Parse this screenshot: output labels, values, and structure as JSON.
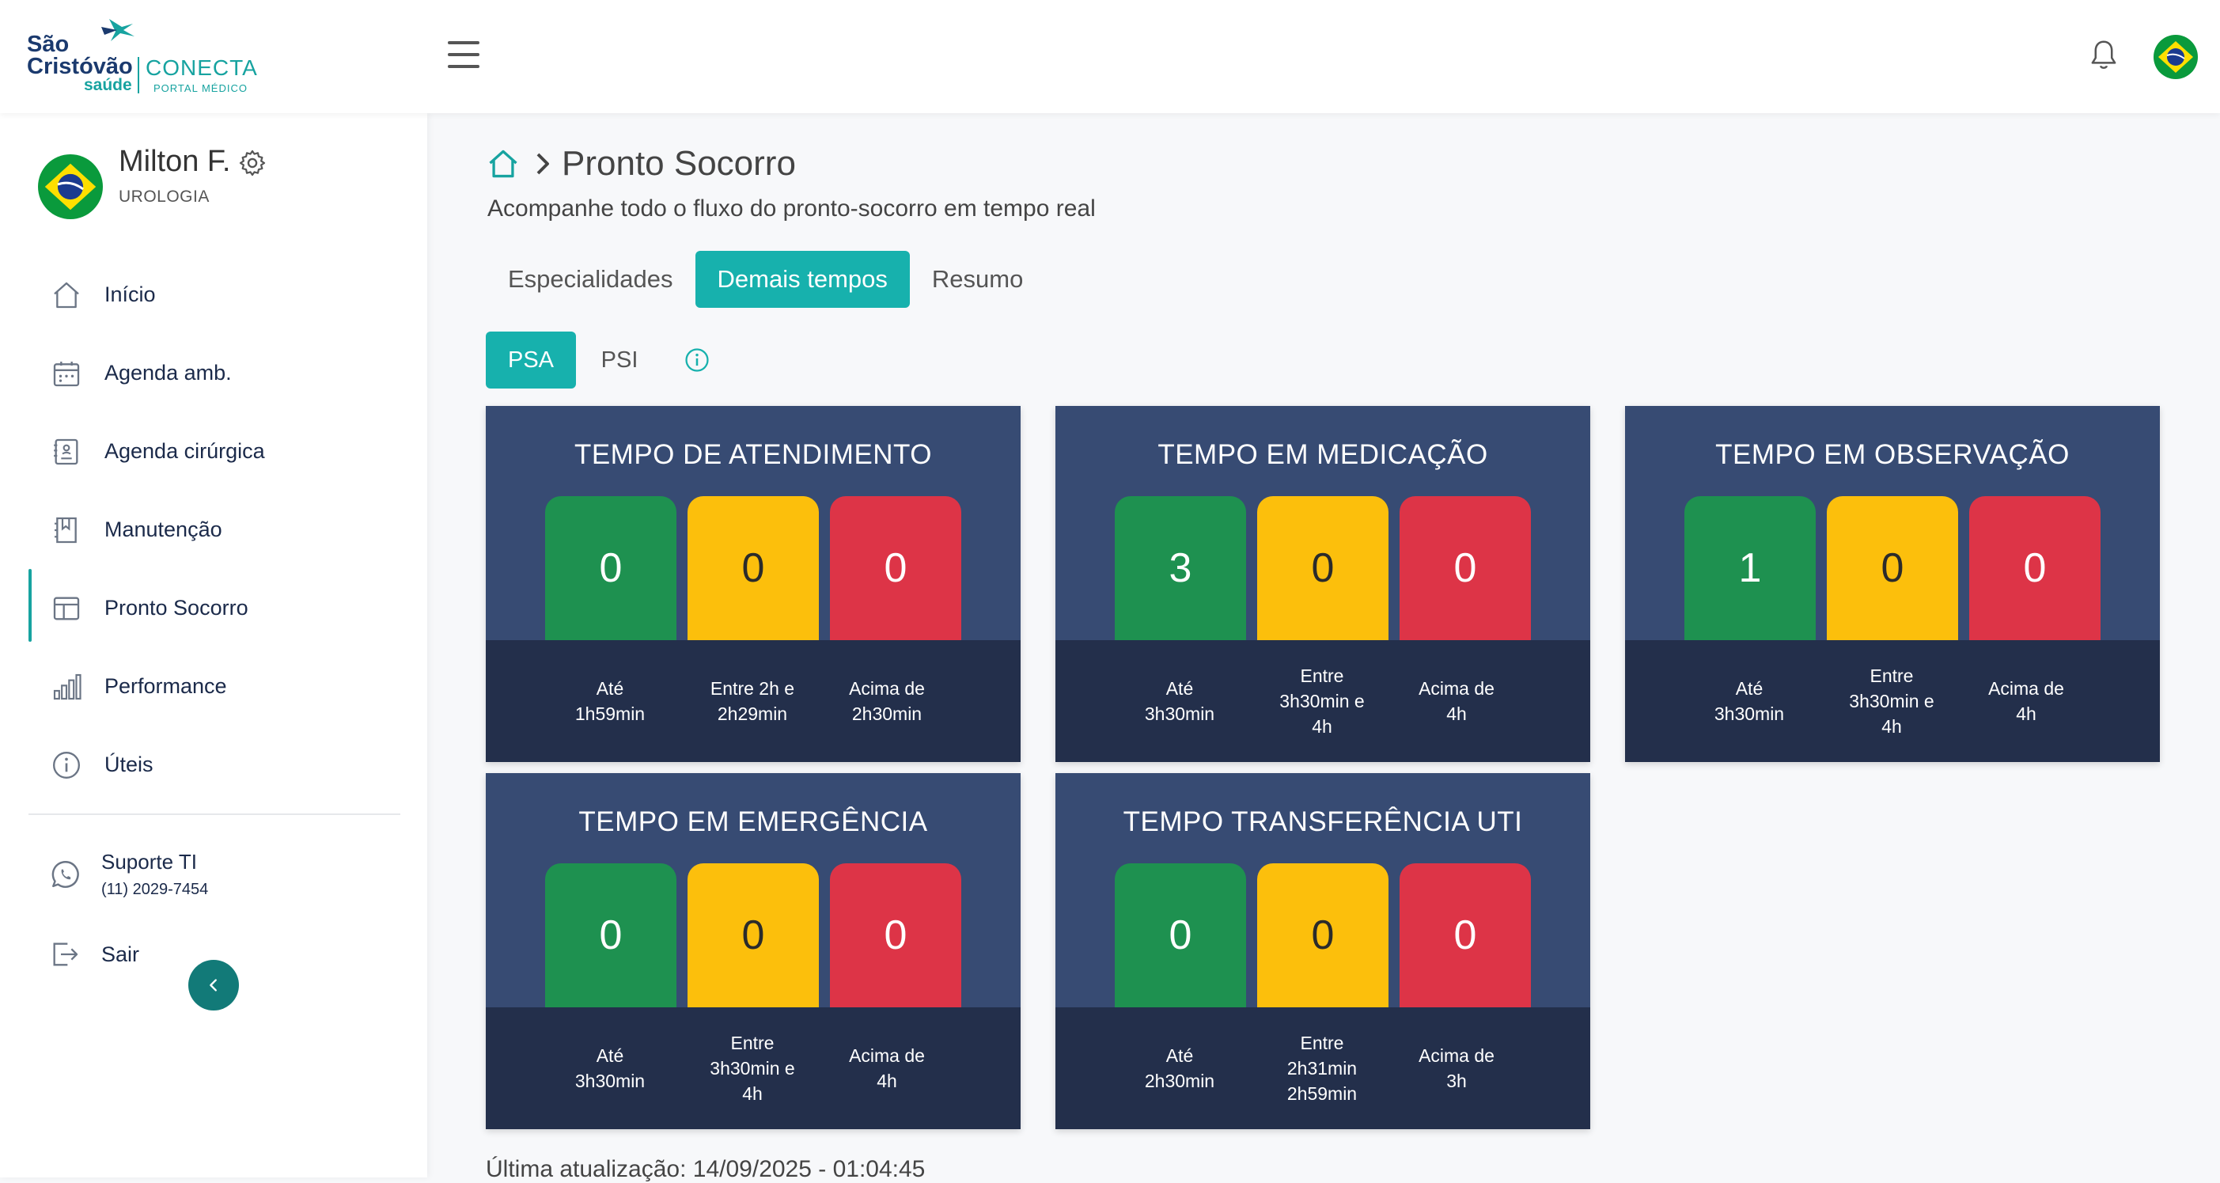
{
  "brand": {
    "line1": "São",
    "line2": "Cristóvão",
    "saude": "saúde",
    "conecta": "CONECTA",
    "portal": "PORTAL MÉDICO"
  },
  "profile": {
    "name": "Milton F.",
    "specialty": "UROLOGIA"
  },
  "nav": [
    {
      "label": "Início",
      "icon": "home-icon"
    },
    {
      "label": "Agenda amb.",
      "icon": "calendar-icon"
    },
    {
      "label": "Agenda cirúrgica",
      "icon": "clipboard-icon"
    },
    {
      "label": "Manutenção",
      "icon": "book-icon"
    },
    {
      "label": "Pronto Socorro",
      "icon": "layout-icon"
    },
    {
      "label": "Performance",
      "icon": "bar-chart-icon"
    },
    {
      "label": "Úteis",
      "icon": "info-icon"
    }
  ],
  "support": {
    "title": "Suporte TI",
    "phone": "(11) 2029-7454"
  },
  "logout": "Sair",
  "page": {
    "title": "Pronto Socorro",
    "subtitle": "Acompanhe todo o fluxo do pronto-socorro em tempo real"
  },
  "tabs": [
    "Especialidades",
    "Demais tempos",
    "Resumo"
  ],
  "subtabs": [
    "PSA",
    "PSI"
  ],
  "cards": [
    {
      "title": "TEMPO DE ATENDIMENTO",
      "values": [
        "0",
        "0",
        "0"
      ],
      "labels": [
        "Até\n1h59min",
        "Entre 2h e\n2h29min",
        "Acima de\n2h30min"
      ]
    },
    {
      "title": "TEMPO EM MEDICAÇÃO",
      "values": [
        "3",
        "0",
        "0"
      ],
      "labels": [
        "Até\n3h30min",
        "Entre\n3h30min e\n4h",
        "Acima de\n4h"
      ]
    },
    {
      "title": "TEMPO EM OBSERVAÇÃO",
      "values": [
        "1",
        "0",
        "0"
      ],
      "labels": [
        "Até\n3h30min",
        "Entre\n3h30min e\n4h",
        "Acima de\n4h"
      ]
    },
    {
      "title": "TEMPO EM EMERGÊNCIA",
      "values": [
        "0",
        "0",
        "0"
      ],
      "labels": [
        "Até\n3h30min",
        "Entre\n3h30min e\n4h",
        "Acima de\n4h"
      ]
    },
    {
      "title": "TEMPO TRANSFERÊNCIA UTI",
      "values": [
        "0",
        "0",
        "0"
      ],
      "labels": [
        "Até\n2h30min",
        "Entre\n2h31min\n2h59min",
        "Acima de\n3h"
      ]
    }
  ],
  "last_update": "Última atualização: 14/09/2025 - 01:04:45",
  "colors": {
    "accent": "#17b1ad",
    "green": "#1e9150",
    "yellow": "#fcbf0c",
    "red": "#dd3447",
    "card": "#374b73",
    "card_footer": "#232f4b"
  }
}
